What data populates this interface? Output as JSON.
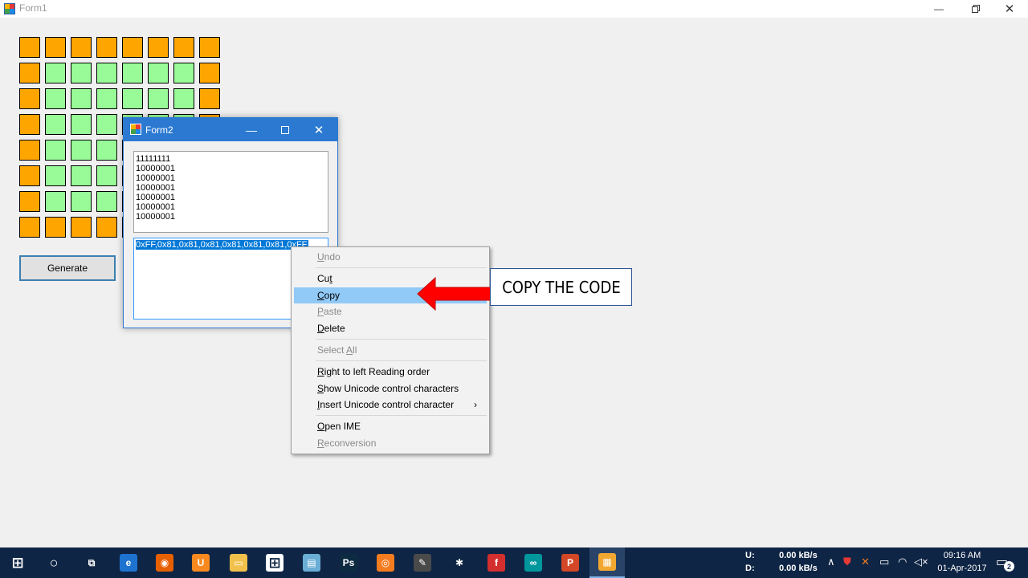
{
  "form1": {
    "title": "Form1",
    "grid": {
      "rows": 8,
      "cols": 8,
      "on_color": "#ffa500",
      "off_color": "#98fb98",
      "pattern": [
        "11111111",
        "10000001",
        "10000001",
        "10000001",
        "10000001",
        "10000001",
        "10000001",
        "11111111"
      ]
    },
    "generate_label": "Generate"
  },
  "form2": {
    "title": "Form2",
    "binary_lines": [
      "11111111",
      "10000001",
      "10000001",
      "10000001",
      "10000001",
      "10000001",
      "10000001"
    ],
    "hex_code": "0xFF,0x81,0x81,0x81,0x81,0x81,0x81,0xFF,"
  },
  "context_menu": {
    "items": [
      {
        "pre": "",
        "u": "U",
        "post": "ndo",
        "disabled": true,
        "highlighted": false
      },
      {
        "pre": "Cu",
        "u": "t",
        "post": "",
        "disabled": false,
        "highlighted": false
      },
      {
        "pre": "",
        "u": "C",
        "post": "opy",
        "disabled": false,
        "highlighted": true
      },
      {
        "pre": "",
        "u": "P",
        "post": "aste",
        "disabled": true,
        "highlighted": false
      },
      {
        "pre": "",
        "u": "D",
        "post": "elete",
        "disabled": false,
        "highlighted": false
      },
      {
        "pre": "Select ",
        "u": "A",
        "post": "ll",
        "disabled": true,
        "highlighted": false
      },
      {
        "pre": "",
        "u": "R",
        "post": "ight to left Reading order",
        "disabled": false,
        "highlighted": false
      },
      {
        "pre": "",
        "u": "S",
        "post": "how Unicode control characters",
        "disabled": false,
        "highlighted": false
      },
      {
        "pre": "",
        "u": "I",
        "post": "nsert Unicode control character",
        "disabled": false,
        "highlighted": false
      },
      {
        "pre": "",
        "u": "O",
        "post": "pen IME",
        "disabled": false,
        "highlighted": false
      },
      {
        "pre": "",
        "u": "R",
        "post": "econversion",
        "disabled": true,
        "highlighted": false
      }
    ],
    "submenu_arrow": "›"
  },
  "annotation": {
    "text": "COPY THE CODE",
    "arrow_color": "#ff0000"
  },
  "taskbar": {
    "net_up_label": "U:",
    "net_down_label": "D:",
    "net_up_value": "0.00 kB/s",
    "net_down_value": "0.00 kB/s",
    "time": "09:16 AM",
    "date": "01-Apr-2017",
    "notification_count": "2",
    "apps": [
      {
        "name": "start-icon",
        "glyph": "⊞",
        "bg": "transparent"
      },
      {
        "name": "cortana-icon",
        "glyph": "○",
        "bg": "transparent"
      },
      {
        "name": "task-view-icon",
        "glyph": "⧉",
        "bg": "transparent"
      },
      {
        "name": "edge-icon",
        "glyph": "e",
        "bg": "#1e73d1"
      },
      {
        "name": "firefox-icon",
        "glyph": "◉",
        "bg": "#e66000"
      },
      {
        "name": "uc-browser-icon",
        "glyph": "U",
        "bg": "#f7891e"
      },
      {
        "name": "file-explorer-icon",
        "glyph": "▭",
        "bg": "#f2c14b"
      },
      {
        "name": "store-icon",
        "glyph": "⊞",
        "bg": "#ffffff"
      },
      {
        "name": "notepad-icon",
        "glyph": "▤",
        "bg": "#6aaed6"
      },
      {
        "name": "photoshop-icon",
        "glyph": "Ps",
        "bg": "#0c2a40"
      },
      {
        "name": "orange-app-icon",
        "glyph": "◎",
        "bg": "#f57c1f"
      },
      {
        "name": "tool-app-icon",
        "glyph": "✎",
        "bg": "#4a4a4a"
      },
      {
        "name": "atom-icon",
        "glyph": "✱",
        "bg": "transparent"
      },
      {
        "name": "f-app-icon",
        "glyph": "f",
        "bg": "#d32f2f"
      },
      {
        "name": "arduino-icon",
        "glyph": "∞",
        "bg": "#00979c"
      },
      {
        "name": "powerpoint-icon",
        "glyph": "P",
        "bg": "#d24726"
      },
      {
        "name": "winforms-app-icon",
        "glyph": "▦",
        "bg": "#f2a830"
      }
    ]
  }
}
